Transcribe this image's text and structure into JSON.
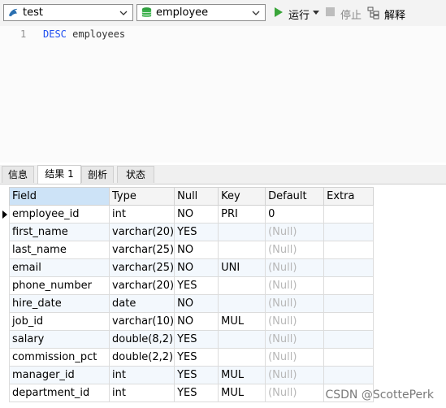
{
  "toolbar": {
    "connection": "test",
    "database": "employee",
    "run_label": "运行",
    "stop_label": "停止",
    "explain_label": "解释"
  },
  "editor": {
    "line_number": "1",
    "keyword": "DESC",
    "rest": " employees"
  },
  "tabs": [
    {
      "label": "信息"
    },
    {
      "label": "结果 1"
    },
    {
      "label": "剖析"
    },
    {
      "label": "状态"
    }
  ],
  "grid": {
    "columns": [
      "Field",
      "Type",
      "Null",
      "Key",
      "Default",
      "Extra"
    ],
    "rows": [
      [
        "employee_id",
        "int",
        "NO",
        "PRI",
        "0",
        ""
      ],
      [
        "first_name",
        "varchar(20)",
        "YES",
        "",
        "(Null)",
        ""
      ],
      [
        "last_name",
        "varchar(25)",
        "NO",
        "",
        "(Null)",
        ""
      ],
      [
        "email",
        "varchar(25)",
        "NO",
        "UNI",
        "(Null)",
        ""
      ],
      [
        "phone_number",
        "varchar(20)",
        "YES",
        "",
        "(Null)",
        ""
      ],
      [
        "hire_date",
        "date",
        "NO",
        "",
        "(Null)",
        ""
      ],
      [
        "job_id",
        "varchar(10)",
        "NO",
        "MUL",
        "(Null)",
        ""
      ],
      [
        "salary",
        "double(8,2)",
        "YES",
        "",
        "(Null)",
        ""
      ],
      [
        "commission_pct",
        "double(2,2)",
        "YES",
        "",
        "(Null)",
        ""
      ],
      [
        "manager_id",
        "int",
        "YES",
        "MUL",
        "(Null)",
        ""
      ],
      [
        "department_id",
        "int",
        "YES",
        "MUL",
        "(Null)",
        ""
      ]
    ]
  },
  "watermark": "CSDN @ScottePerk",
  "colors": {
    "run_green": "#3aa53a",
    "db_green": "#2e9e3e",
    "keyword_blue": "#1f4ef0",
    "header_selected": "#cde3f7",
    "null_gray": "#b7b7b7"
  },
  "icons": {
    "connection": "mysql-dolphin-icon",
    "database": "database-icon",
    "run": "play-icon",
    "stop": "stop-icon",
    "explain": "explain-icon"
  }
}
